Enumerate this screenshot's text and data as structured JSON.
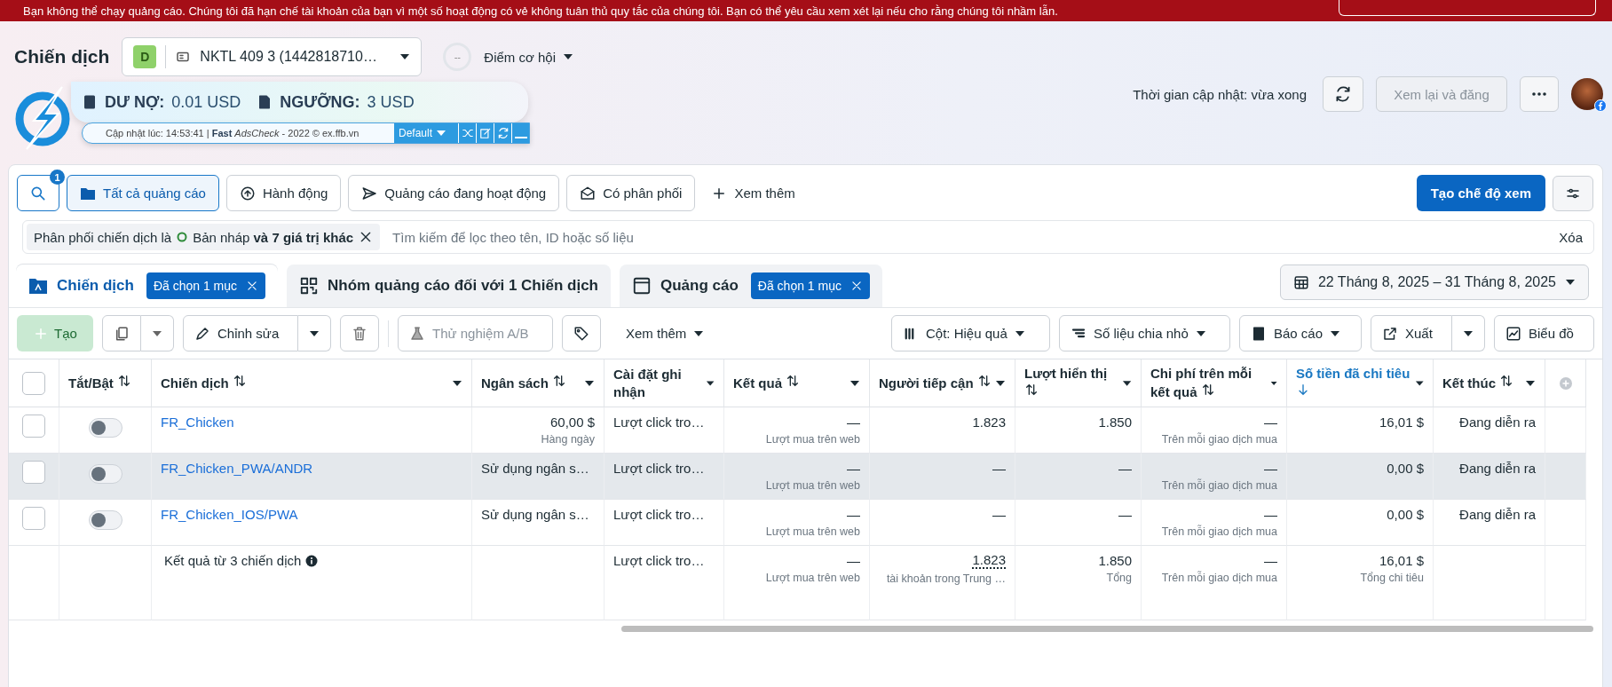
{
  "banner": {
    "message": "Bạn không thể chạy quảng cáo. Chúng tôi đã hạn chế tài khoản của bạn vì một số hoạt động có vẻ không tuân thủ quy tắc của chúng tôi. Bạn có thể yêu cầu xem xét lại nếu cho rằng chúng tôi nhầm lẫn."
  },
  "header": {
    "title": "Chiến dịch",
    "account_badge": "D",
    "account_name": "NKTL 409 3 (1442818710…",
    "score": "--",
    "opportunity": "Điểm cơ hội",
    "updated": "Thời gian cập nhật: vừa xong",
    "review_button": "Xem lại và đăng",
    "review_disabled": true
  },
  "adscheck": {
    "debt_label": "DƯ NỢ:",
    "debt": "0.01 USD",
    "threshold_label": "NGƯỠNG:",
    "threshold": "3 USD",
    "status": "Cập nhật lúc: 14:53:41 | **Fast** *AdsCheck* - 2022 © ex.ffb.vn",
    "preset": "Default"
  },
  "toolbar": {
    "search_count": "1",
    "filters": [
      {
        "label": "Tất cả quảng cáo",
        "kind": "folder",
        "selected": true
      },
      {
        "label": "Hành động",
        "kind": "action",
        "selected": false
      },
      {
        "label": "Quảng cáo đang hoạt động",
        "kind": "send",
        "selected": false
      },
      {
        "label": "Có phân phối",
        "kind": "mail",
        "selected": false
      }
    ],
    "more": "Xem thêm",
    "create_view": "Tạo chế độ xem"
  },
  "filter": {
    "chip_prefix": "Phân phối chiến dịch là",
    "chip_value": "Bản nháp **và 7 giá trị khác**",
    "placeholder": "Tìm kiếm để lọc theo tên, ID hoặc số liệu",
    "clear": "Xóa"
  },
  "level_tabs": [
    {
      "label": "Chiến dịch",
      "kind": "campaign",
      "selected": true,
      "chip": "Đã chọn 1 mục"
    },
    {
      "label": "Nhóm quảng cáo đối với 1 Chiến dịch",
      "kind": "adset",
      "selected": false
    },
    {
      "label": "Quảng cáo",
      "kind": "ad",
      "selected": false,
      "chip": "Đã chọn 1 mục"
    }
  ],
  "date_range": "22 Tháng 8, 2025 – 31 Tháng 8, 2025",
  "actions": {
    "create": "Tạo",
    "create_disabled": true,
    "edit": "Chỉnh sửa",
    "ab_test": "Thử nghiệm A/B",
    "ab_disabled": true,
    "more": "Xem thêm",
    "columns": "Cột: Hiệu quả",
    "breakdown": "Số liệu chia nhỏ",
    "reports": "Báo cáo",
    "export": "Xuất",
    "chart": "Biểu đồ"
  },
  "table": {
    "select_all_checked": false,
    "columns": [
      {
        "label": "Tắt/Bật",
        "sortable": true,
        "menu": false,
        "selected": false
      },
      {
        "label": "Chiến dịch",
        "sortable": true,
        "menu": true,
        "selected": false
      },
      {
        "label": "Ngân sách",
        "sortable": true,
        "menu": true,
        "selected": false
      },
      {
        "label": "Cài đặt ghi nhận",
        "sortable": false,
        "menu": true,
        "selected": false
      },
      {
        "label": "Kết quả",
        "sortable": true,
        "menu": true,
        "selected": false
      },
      {
        "label": "Người tiếp cận",
        "sortable": true,
        "menu": true,
        "selected": false
      },
      {
        "label": "Lượt hiển thị",
        "sortable": true,
        "menu": true,
        "selected": false
      },
      {
        "label": "Chi phí trên mỗi kết quả",
        "sortable": true,
        "menu": true,
        "selected": false
      },
      {
        "label": "Số tiền đã chi tiêu",
        "sortable": true,
        "menu": true,
        "selected": true
      },
      {
        "label": "Kết thúc",
        "sortable": true,
        "menu": true,
        "selected": false
      }
    ],
    "rows": [
      {
        "checked": false,
        "on": false,
        "hovered": false,
        "name": "FR_Chicken",
        "budget": "60,00 $",
        "budget_note": "Hàng ngày",
        "attribution": "Lượt click tro…",
        "result": "—",
        "result_note": "Lượt mua trên web",
        "reach": "1.823",
        "impressions": "1.850",
        "cpr": "—",
        "cpr_note": "Trên mỗi giao dịch mua",
        "spent": "16,01 $",
        "end": "Đang diễn ra"
      },
      {
        "checked": false,
        "on": false,
        "hovered": true,
        "name": "FR_Chicken_PWA/ANDR",
        "budget": "Sử dụng ngân s…",
        "attribution": "Lượt click tro…",
        "result": "—",
        "result_note": "Lượt mua trên web",
        "reach": "—",
        "impressions": "—",
        "cpr": "—",
        "cpr_note": "Trên mỗi giao dịch mua",
        "spent": "0,00 $",
        "end": "Đang diễn ra"
      },
      {
        "checked": false,
        "on": false,
        "hovered": false,
        "name": "FR_Chicken_IOS/PWA",
        "budget": "Sử dụng ngân s…",
        "attribution": "Lượt click tro…",
        "result": "—",
        "result_note": "Lượt mua trên web",
        "reach": "—",
        "impressions": "—",
        "cpr": "—",
        "cpr_note": "Trên mỗi giao dịch mua",
        "spent": "0,00 $",
        "end": "Đang diễn ra"
      }
    ],
    "summary": {
      "label": "Kết quả từ 3 chiến dịch",
      "attribution": "Lượt click tro…",
      "result": "—",
      "result_note": "Lượt mua trên web",
      "reach": "1.823",
      "reach_note": "tài khoản trong Trung …",
      "impressions": "1.850",
      "impressions_note": "Tổng",
      "cpr": "—",
      "cpr_note": "Trên mỗi giao dịch mua",
      "spent": "16,01 $",
      "spent_note": "Tổng chi tiêu"
    }
  }
}
